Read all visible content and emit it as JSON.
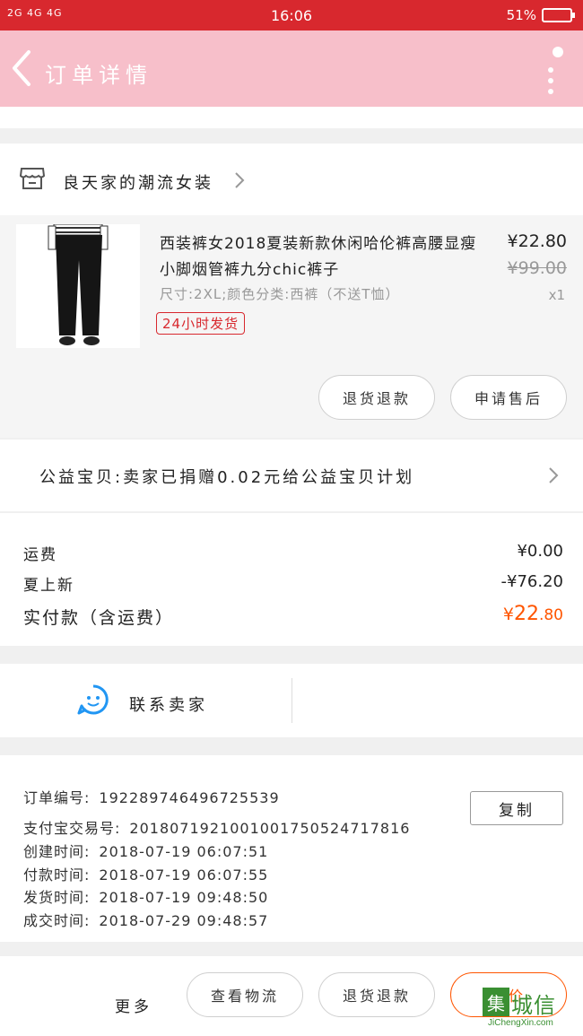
{
  "status_bar": {
    "network": "2G 4G 4G",
    "time": "16:06",
    "battery": "51%",
    "battery_level": 0.51
  },
  "header": {
    "title": "订单详情"
  },
  "shop": {
    "name": "良天家的潮流女装"
  },
  "product": {
    "title": "西装裤女2018夏装新款休闲哈伦裤高腰显瘦小脚烟管裤九分chic裤子",
    "price": "¥22.80",
    "original_price": "¥99.00",
    "spec": "尺寸:2XL;颜色分类:西裤（不送T恤）",
    "quantity": "x1",
    "tag": "24小时发货"
  },
  "actions": {
    "refund": "退货退款",
    "after_sale": "申请售后"
  },
  "charity": {
    "text": "公益宝贝:卖家已捐赠0.02元给公益宝贝计划"
  },
  "fees": {
    "shipping_label": "运费",
    "shipping_value": "¥0.00",
    "discount_label": "夏上新",
    "discount_value": "-¥76.20",
    "paid_label": "实付款（含运费）",
    "paid_currency": "¥",
    "paid_int": "22",
    "paid_dec": ".80"
  },
  "contact": {
    "label": "联系卖家"
  },
  "order": {
    "number_label": "订单编号:",
    "number": "192289746496725539",
    "alipay_label": "支付宝交易号:",
    "alipay": "2018071921001001750524717816",
    "created_label": "创建时间:",
    "created": "2018-07-19 06:07:51",
    "paid_label": "付款时间:",
    "paid": "2018-07-19 06:07:55",
    "shipped_label": "发货时间:",
    "shipped": "2018-07-19 09:48:50",
    "done_label": "成交时间:",
    "done": "2018-07-29 09:48:57",
    "copy_label": "复制"
  },
  "footer": {
    "more": "更多",
    "logistics": "查看物流",
    "refund": "退货退款",
    "review": "评价"
  },
  "watermark": {
    "brand": "集城信",
    "url": "JiChengXin.com"
  },
  "colors": {
    "status_bar": "#d8282e",
    "header": "#f7bfca",
    "accent": "#ff5500"
  }
}
